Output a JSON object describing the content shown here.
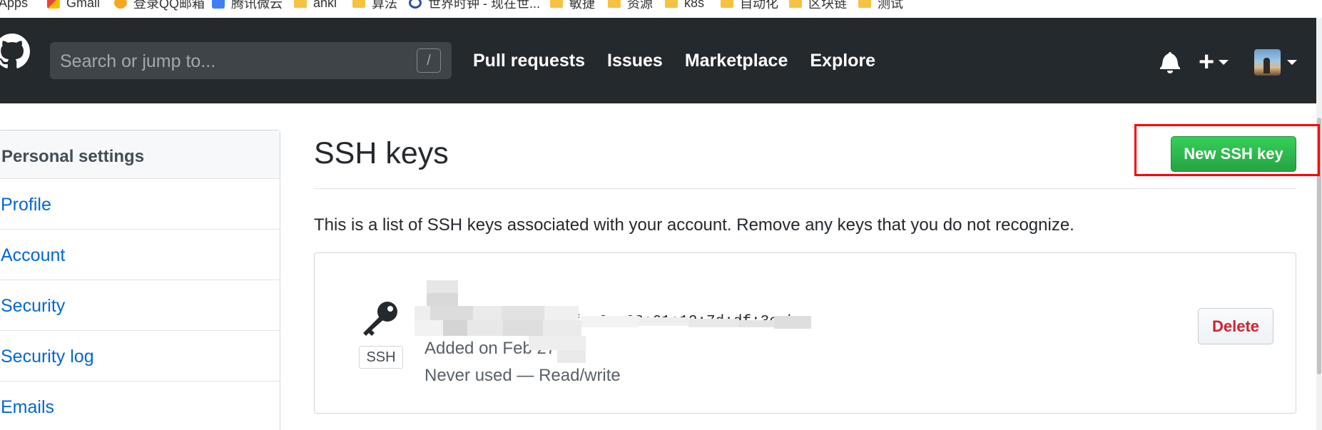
{
  "bookmarks": [
    {
      "label": "Apps",
      "icon": "apps-grid-icon"
    },
    {
      "label": "Gmail",
      "icon": "gmail-icon"
    },
    {
      "label": "登录QQ邮箱",
      "icon": "qq-mail-icon"
    },
    {
      "label": "腾讯微云",
      "icon": "weiyun-icon"
    },
    {
      "label": "anki",
      "icon": "folder-icon"
    },
    {
      "label": "算法",
      "icon": "folder-icon"
    },
    {
      "label": "世界时钟 - 现在世...",
      "icon": "clock-icon"
    },
    {
      "label": "敏捷",
      "icon": "folder-icon"
    },
    {
      "label": "资源",
      "icon": "folder-icon"
    },
    {
      "label": "k8s",
      "icon": "folder-icon"
    },
    {
      "label": "自动化",
      "icon": "folder-icon"
    },
    {
      "label": "区块链",
      "icon": "folder-icon"
    },
    {
      "label": "测试",
      "icon": "folder-icon"
    }
  ],
  "header": {
    "search_placeholder": "Search or jump to...",
    "search_shortcut": "/",
    "nav": [
      "Pull requests",
      "Issues",
      "Marketplace",
      "Explore"
    ],
    "icons": {
      "logo": "github-logo-icon",
      "notifications": "bell-icon",
      "create": "plus-icon",
      "avatar": "user-avatar"
    }
  },
  "sidebar": {
    "heading": "Personal settings",
    "items": [
      "Profile",
      "Account",
      "Security",
      "Security log",
      "Emails"
    ]
  },
  "main": {
    "title": "SSH keys",
    "new_key_button": "New SSH key",
    "description": "This is a list of SSH keys associated with your account. Remove any keys that you do not recognize.",
    "key": {
      "type_badge": "SSH",
      "fingerprint_visible": "fe:6c:68:61:12:7d:df:3e:b",
      "added_visible": "Added on Feb 27,",
      "usage": "Never used — Read/write",
      "delete_button": "Delete"
    }
  },
  "colors": {
    "header_bg": "#24292e",
    "link": "#0366d6",
    "primary_button": "#28a745",
    "danger_text": "#cb2431",
    "highlight_border": "#ff0000"
  }
}
